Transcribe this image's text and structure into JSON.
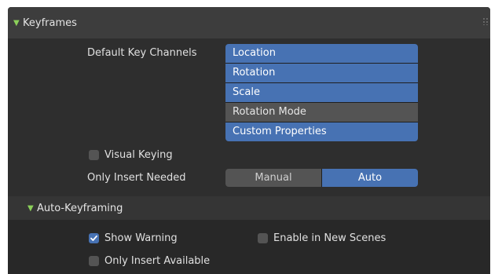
{
  "keyframes_panel": {
    "title": "Keyframes",
    "default_key_channels": {
      "label": "Default Key Channels",
      "items": [
        {
          "label": "Location",
          "selected": true
        },
        {
          "label": "Rotation",
          "selected": true
        },
        {
          "label": "Scale",
          "selected": true
        },
        {
          "label": "Rotation Mode",
          "selected": false
        },
        {
          "label": "Custom Properties",
          "selected": true
        }
      ]
    },
    "visual_keying": {
      "label": "Visual Keying",
      "checked": false
    },
    "only_insert_needed": {
      "label": "Only Insert Needed",
      "options": [
        "Manual",
        "Auto"
      ],
      "selected": "Auto"
    }
  },
  "auto_keyframing": {
    "title": "Auto-Keyframing",
    "show_warning": {
      "label": "Show Warning",
      "checked": true
    },
    "enable_in_new_scenes": {
      "label": "Enable in New Scenes",
      "checked": false
    },
    "only_insert_available": {
      "label": "Only Insert Available",
      "checked": false
    }
  },
  "colors": {
    "accent": "#4772b3",
    "panel_bg": "#2e2e2e",
    "header_bg": "#3d3d3d",
    "toggle_arrow": "#8bd05a",
    "off_item": "#545454"
  },
  "icons": {
    "panel_toggle": "triangle-down-icon",
    "checkmark": "checkmark-icon",
    "drag": "drag-handle-icon"
  }
}
